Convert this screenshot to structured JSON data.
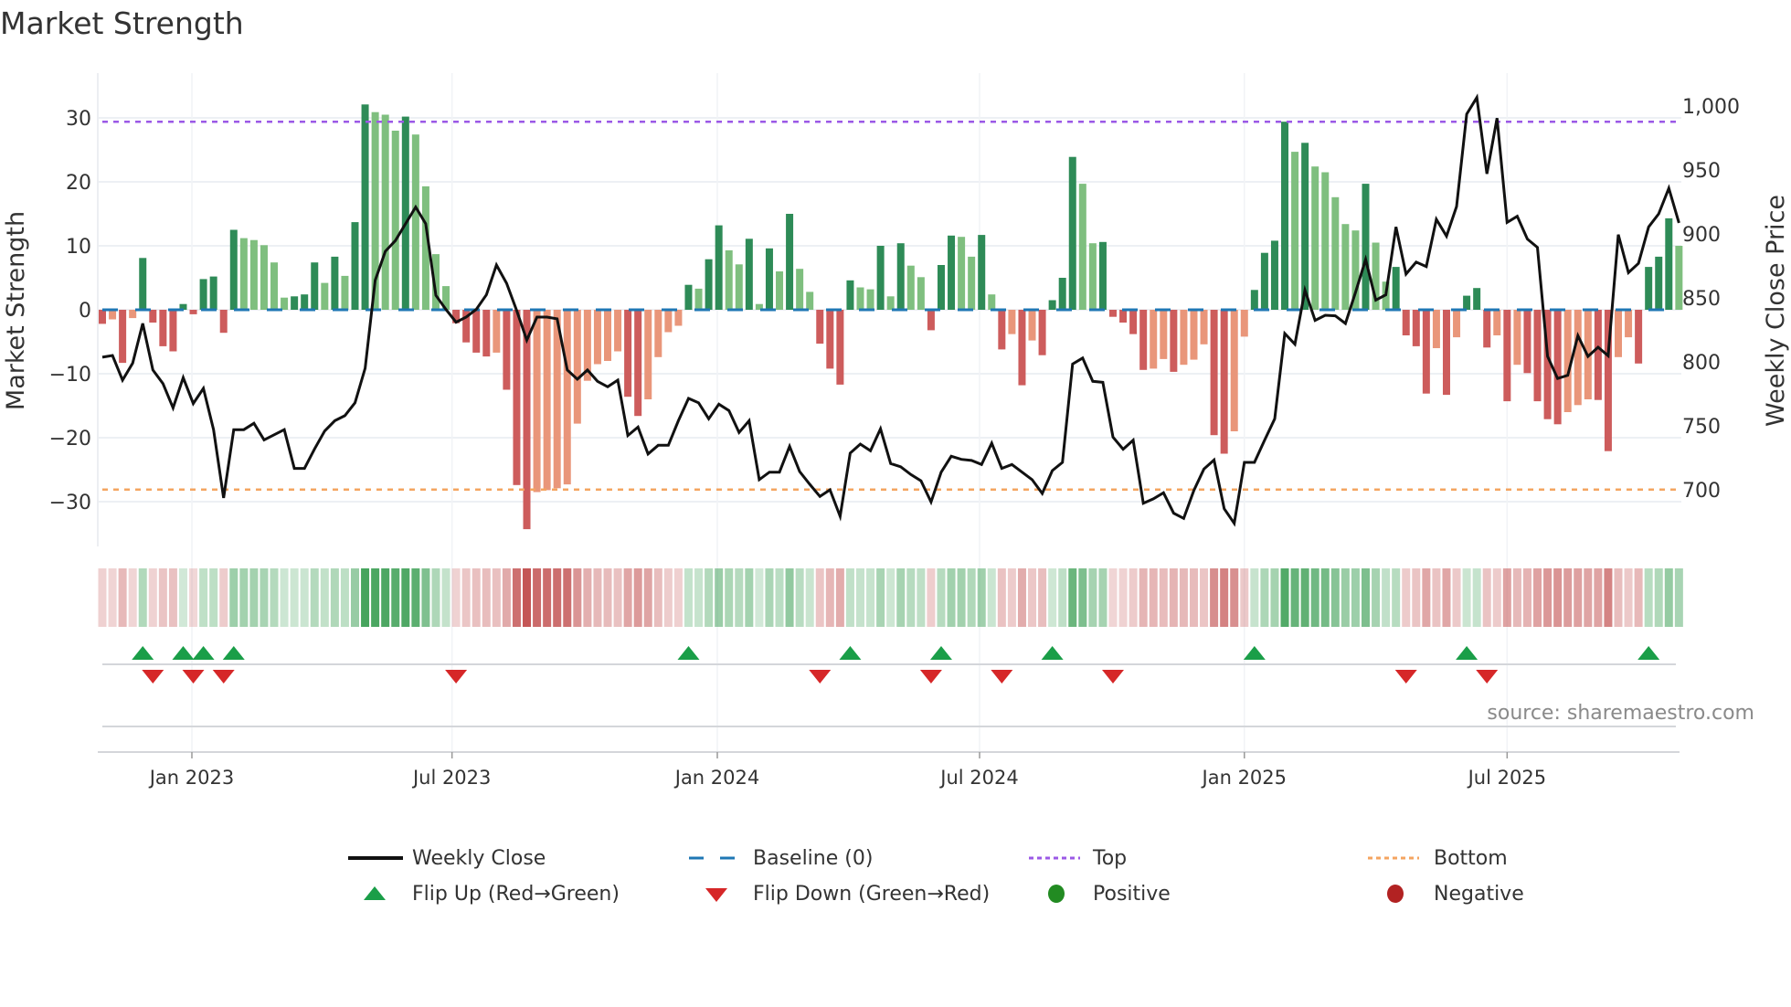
{
  "title": "Market Strength",
  "source": "source: sharemaestro.com",
  "colors": {
    "pos_strong": "#2e8b57",
    "pos_weak": "#7fbf7f",
    "neg_strong": "#cd5c5c",
    "neg_weak": "#e9967a",
    "price": "#111111",
    "baseline": "#1f77b4",
    "top": "#9b59e6",
    "bottom": "#f4a460",
    "flip_up": "#1a9e48",
    "flip_down": "#d62728",
    "positive": "#228b22",
    "negative": "#b22222"
  },
  "legend": [
    {
      "label": "Weekly Close",
      "key": "price"
    },
    {
      "label": "Baseline (0)",
      "key": "baseline"
    },
    {
      "label": "Top",
      "key": "top"
    },
    {
      "label": "Bottom",
      "key": "bottom"
    },
    {
      "label": "Flip Up (Red→Green)",
      "key": "flip_up"
    },
    {
      "label": "Flip Down (Green→Red)",
      "key": "flip_down"
    },
    {
      "label": "Positive",
      "key": "positive"
    },
    {
      "label": "Negative",
      "key": "negative"
    }
  ],
  "chart_data": {
    "type": "bar",
    "title": "Market Strength",
    "xlabel": "",
    "ylabel": "Market Strength",
    "ylabel_right": "Weekly Close Price",
    "ylim": [
      -37,
      37
    ],
    "ylim_right": [
      655.7,
      1025.7
    ],
    "y_ticks": [
      30,
      20,
      10,
      0,
      -10,
      -20,
      -30
    ],
    "y_tick_labels": [
      "30",
      "20",
      "10",
      "0",
      "−10",
      "−20",
      "−30"
    ],
    "y_right_ticks": [
      1000,
      950,
      900,
      850,
      800,
      750,
      700
    ],
    "y_right_tick_labels": [
      "1,000",
      "950",
      "900",
      "850",
      "800",
      "750",
      "700"
    ],
    "x_unit": "week index (0 = first weekly bar, ~Nov 2022)",
    "x_ticks": [
      8.86,
      34.6,
      60.85,
      86.8,
      113.0,
      139.0
    ],
    "x_tick_labels": [
      "Jan 2023",
      "Jul 2023",
      "Jan 2024",
      "Jul 2024",
      "Jan 2025",
      "Jul 2025"
    ],
    "top_level": 29.4,
    "bottom_level": -28.1,
    "baseline": 0,
    "grid": true,
    "legend_position": "bottom",
    "strength": [
      -2.2,
      -1.5,
      -8.3,
      -1.3,
      8.1,
      -2.0,
      -5.7,
      -6.5,
      0.9,
      -0.7,
      4.8,
      5.2,
      -3.6,
      12.5,
      11.2,
      10.9,
      10.1,
      7.4,
      1.9,
      2.1,
      2.4,
      7.4,
      4.2,
      8.3,
      5.3,
      13.7,
      32.1,
      30.9,
      30.5,
      28.0,
      30.2,
      27.4,
      19.3,
      8.7,
      3.7,
      -2.1,
      -5.1,
      -6.7,
      -7.3,
      -6.7,
      -12.5,
      -27.4,
      -34.3,
      -28.5,
      -28.2,
      -27.9,
      -27.3,
      -17.8,
      -11.1,
      -8.5,
      -8.0,
      -6.5,
      -13.6,
      -16.6,
      -14.0,
      -7.4,
      -3.5,
      -2.5,
      3.9,
      3.3,
      7.9,
      13.2,
      9.3,
      7.1,
      11.1,
      0.9,
      9.6,
      6.0,
      15.0,
      6.4,
      2.8,
      -5.3,
      -9.2,
      -11.7,
      4.6,
      3.5,
      3.2,
      10.0,
      2.1,
      10.4,
      6.9,
      5.1,
      -3.2,
      7.0,
      11.6,
      11.4,
      8.3,
      11.7,
      2.4,
      -6.2,
      -3.8,
      -11.8,
      -4.8,
      -7.1,
      1.5,
      5.0,
      23.9,
      19.7,
      10.4,
      10.6,
      -1.1,
      -2.0,
      -3.8,
      -9.4,
      -9.2,
      -7.7,
      -9.7,
      -8.6,
      -7.8,
      -5.4,
      -19.6,
      -22.5,
      -19.0,
      -4.2,
      3.1,
      8.9,
      10.8,
      29.4,
      24.7,
      26.1,
      22.4,
      21.5,
      17.6,
      13.4,
      12.4,
      19.7,
      10.5,
      4.4,
      6.7,
      -4.0,
      -5.7,
      -13.1,
      -6.0,
      -13.3,
      -4.3,
      2.2,
      3.4,
      -5.9,
      -4.0,
      -14.3,
      -8.6,
      -9.9,
      -14.3,
      -17.1,
      -17.9,
      -16.0,
      -14.9,
      -14.0,
      -14.1,
      -22.1,
      -7.4,
      -4.3,
      -8.4,
      6.7,
      8.3,
      14.3,
      10.0
    ],
    "weekly_close": [
      803.6,
      805,
      785.7,
      799,
      830,
      793.6,
      782.9,
      764,
      787.6,
      767.4,
      779.3,
      747,
      693.6,
      747,
      747,
      752,
      739,
      743,
      747,
      716.7,
      716.7,
      732,
      745.9,
      754,
      757.9,
      768,
      795,
      863.8,
      886.4,
      894.8,
      907.9,
      921,
      907.9,
      852,
      841,
      831,
      835,
      841,
      852.4,
      875.7,
      861.4,
      840,
      817,
      835,
      835,
      833.6,
      793.6,
      786.4,
      793.6,
      784.8,
      780.5,
      785.7,
      742.4,
      749,
      728,
      734.8,
      734.8,
      754,
      771.4,
      768,
      755.5,
      766.9,
      761.9,
      744.8,
      754,
      707.9,
      713.8,
      713.8,
      734,
      714.3,
      704.3,
      694.8,
      700,
      679.3,
      728.6,
      735.7,
      730.5,
      747.6,
      720.5,
      718,
      711.9,
      707,
      690.5,
      713.8,
      726.2,
      723.8,
      722.9,
      719.8,
      736.4,
      716.7,
      719.8,
      713.8,
      707.9,
      697.1,
      715,
      721.4,
      798.3,
      803,
      784.8,
      784,
      741.2,
      731.7,
      738.8,
      689.5,
      692.9,
      697.6,
      681.7,
      677.6,
      699.5,
      716.2,
      723.3,
      685.2,
      673.8,
      721.4,
      721.4,
      738.8,
      755.5,
      822.1,
      813.8,
      856,
      832.4,
      836.4,
      836,
      830,
      854.3,
      880,
      848.3,
      852.4,
      905.5,
      868.6,
      878,
      874.5,
      911.4,
      898.3,
      921.4,
      993.6,
      1006.6,
      947,
      990.5,
      909,
      913.8,
      896,
      889.5,
      804.3,
      787,
      789.5,
      820.5,
      804.3,
      811.4,
      804.8,
      899.5,
      869.8,
      877,
      905.5,
      915.7,
      935.7,
      908.6
    ],
    "flip_up": [
      4,
      8,
      10,
      13,
      58,
      74,
      83,
      94,
      114,
      135,
      153
    ],
    "flip_down": [
      5,
      9,
      12,
      35,
      71,
      82,
      89,
      100,
      129,
      137
    ]
  }
}
